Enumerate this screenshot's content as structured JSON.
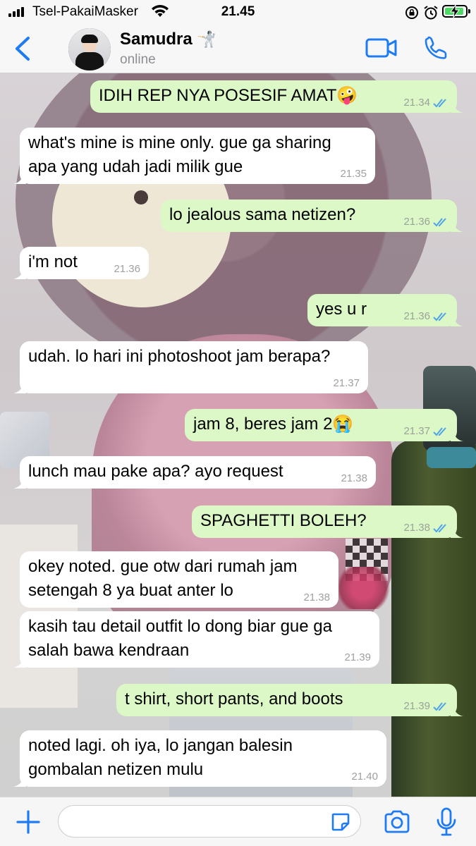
{
  "status_bar": {
    "carrier": "Tsel-PakaiMasker",
    "time": "21.45"
  },
  "header": {
    "contact_name": "Samudra",
    "contact_emoji": "🤺",
    "contact_status": "online",
    "icons": [
      "back-icon",
      "avatar",
      "video-icon",
      "phone-icon"
    ]
  },
  "messages": [
    {
      "dir": "out",
      "text": "IDIH REP NYA POSESIF AMAT🤪",
      "time": "21.34"
    },
    {
      "dir": "in",
      "text": "what's mine is mine only. gue ga sharing\napa yang udah jadi milik gue",
      "time": "21.35"
    },
    {
      "dir": "out",
      "text": "lo jealous sama netizen?",
      "time": "21.36"
    },
    {
      "dir": "in",
      "text": "i'm not",
      "time": "21.36"
    },
    {
      "dir": "out",
      "text": "yes u r",
      "time": "21.36"
    },
    {
      "dir": "in",
      "text": "udah. lo hari ini photoshoot jam berapa?",
      "time": "21.37"
    },
    {
      "dir": "out",
      "text": "jam 8, beres jam 2😭",
      "time": "21.37"
    },
    {
      "dir": "in",
      "text": "lunch mau pake apa? ayo request",
      "time": "21.38"
    },
    {
      "dir": "out",
      "text": "SPAGHETTI BOLEH?",
      "time": "21.38"
    },
    {
      "dir": "in",
      "text": "okey noted. gue otw dari rumah jam\nsetengah 8 ya buat anter lo",
      "time": "21.38"
    },
    {
      "dir": "in",
      "text": "kasih tau detail outfit lo dong biar gue ga\nsalah bawa kendraan",
      "time": "21.39"
    },
    {
      "dir": "out",
      "text": "t shirt, short pants, and boots",
      "time": "21.39"
    },
    {
      "dir": "in",
      "text": "noted lagi. oh iya, lo jangan balesin\ngombalan netizen mulu",
      "time": "21.40"
    }
  ],
  "input_bar": {
    "placeholder": "",
    "icons": [
      "plus-icon",
      "sticker-icon",
      "camera-icon",
      "microphone-icon"
    ]
  },
  "colors": {
    "accent": "#1f7bf4",
    "outgoing_bubble": "#dcf8c6",
    "incoming_bubble": "#ffffff",
    "read_ticks": "#4fa3e8"
  }
}
